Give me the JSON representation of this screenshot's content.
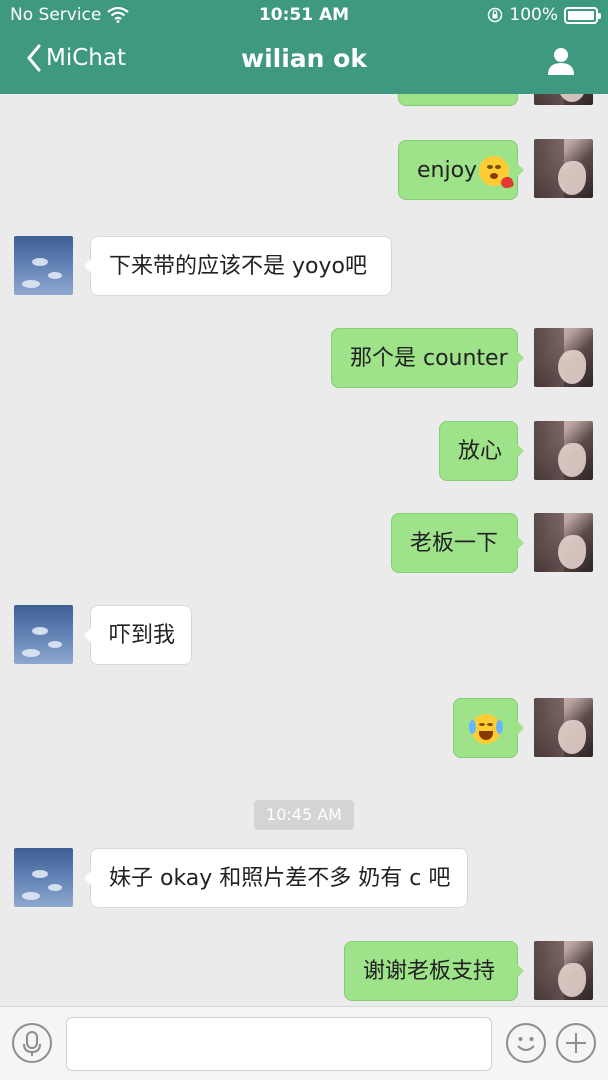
{
  "status_bar": {
    "carrier": "No Service",
    "time": "10:51 AM",
    "battery": "100%"
  },
  "nav": {
    "back_label": "MiChat",
    "title": "wilian ok"
  },
  "messages": [
    {
      "side": "out",
      "text": "enjoy",
      "emoji": "heart-kiss-emoji"
    },
    {
      "side": "in",
      "text": "下来带的应该不是 yoyo吧"
    },
    {
      "side": "out",
      "text": "那个是 counter"
    },
    {
      "side": "out",
      "text": "放心"
    },
    {
      "side": "out",
      "text": "老板一下"
    },
    {
      "side": "in",
      "text": "吓到我"
    },
    {
      "side": "out",
      "text": "",
      "emoji": "tears-of-joy-emoji"
    },
    {
      "side": "in",
      "text": "妹子 okay 和照片差不多 奶有 c 吧"
    },
    {
      "side": "out",
      "text": "谢谢老板支持"
    }
  ],
  "timestamp": "10:45 AM",
  "input": {
    "placeholder": "",
    "value": ""
  },
  "colors": {
    "header": "#3f9880",
    "bubble_out": "#9ee38a",
    "bubble_in": "#ffffff",
    "background": "#ebebeb"
  }
}
